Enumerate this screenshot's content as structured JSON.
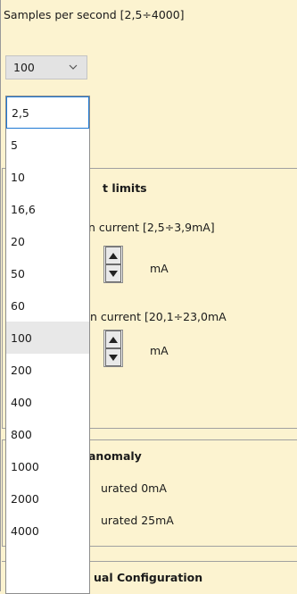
{
  "sampling": {
    "label": "Samples per second [2,5÷4000]",
    "selected": "100"
  },
  "dropdown": {
    "options": [
      "2,5",
      "5",
      "10",
      "16,6",
      "20",
      "50",
      "60",
      "100",
      "200",
      "400",
      "800",
      "1000",
      "2000",
      "4000"
    ],
    "focused_option": "2,5",
    "current_option": "100"
  },
  "current_limits": {
    "title": "t limits",
    "min_label": "n current [2,5÷3,9mA]",
    "min_unit": "mA",
    "max_label": "n current [20,1÷23,0mA",
    "max_unit": "mA"
  },
  "anomaly": {
    "title": "anomaly",
    "option1": "urated  0mA",
    "option2": "urated 25mA"
  },
  "manual": {
    "title": "ual Configuration"
  },
  "colors": {
    "panel_bg": "#fcf3d0",
    "selection_border": "#1e79d3",
    "current_bg": "#e8e8e8"
  }
}
